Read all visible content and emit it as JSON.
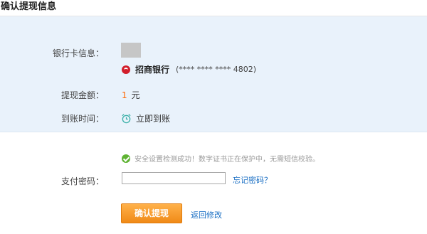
{
  "header": {
    "title": "确认提现信息"
  },
  "form": {
    "card_label": "银行卡信息：",
    "bank_name": "招商银行",
    "card_mask": "(**** **** **** 4802)",
    "amount_label": "提现金额：",
    "amount_value": "1",
    "amount_unit": "元",
    "arrival_label": "到账时间：",
    "arrival_value": "立即到账",
    "security_notice": "安全设置检测成功！数字证书正在保护中，无需短信校验。",
    "password_label": "支付密码：",
    "forgot_password": "忘记密码？",
    "confirm_button": "确认提现",
    "back_link": "返回修改"
  },
  "icons": {
    "bank_logo": "cmb-bank-logo-icon",
    "arrival": "alarm-clock-icon",
    "security": "check-circle-icon"
  },
  "colors": {
    "panel_bg": "#e9f2fb",
    "amount": "#ff6600",
    "link": "#1a6fc4",
    "button": "#f5961e",
    "success": "#5fb333",
    "bank_logo": "#d21e2b"
  }
}
